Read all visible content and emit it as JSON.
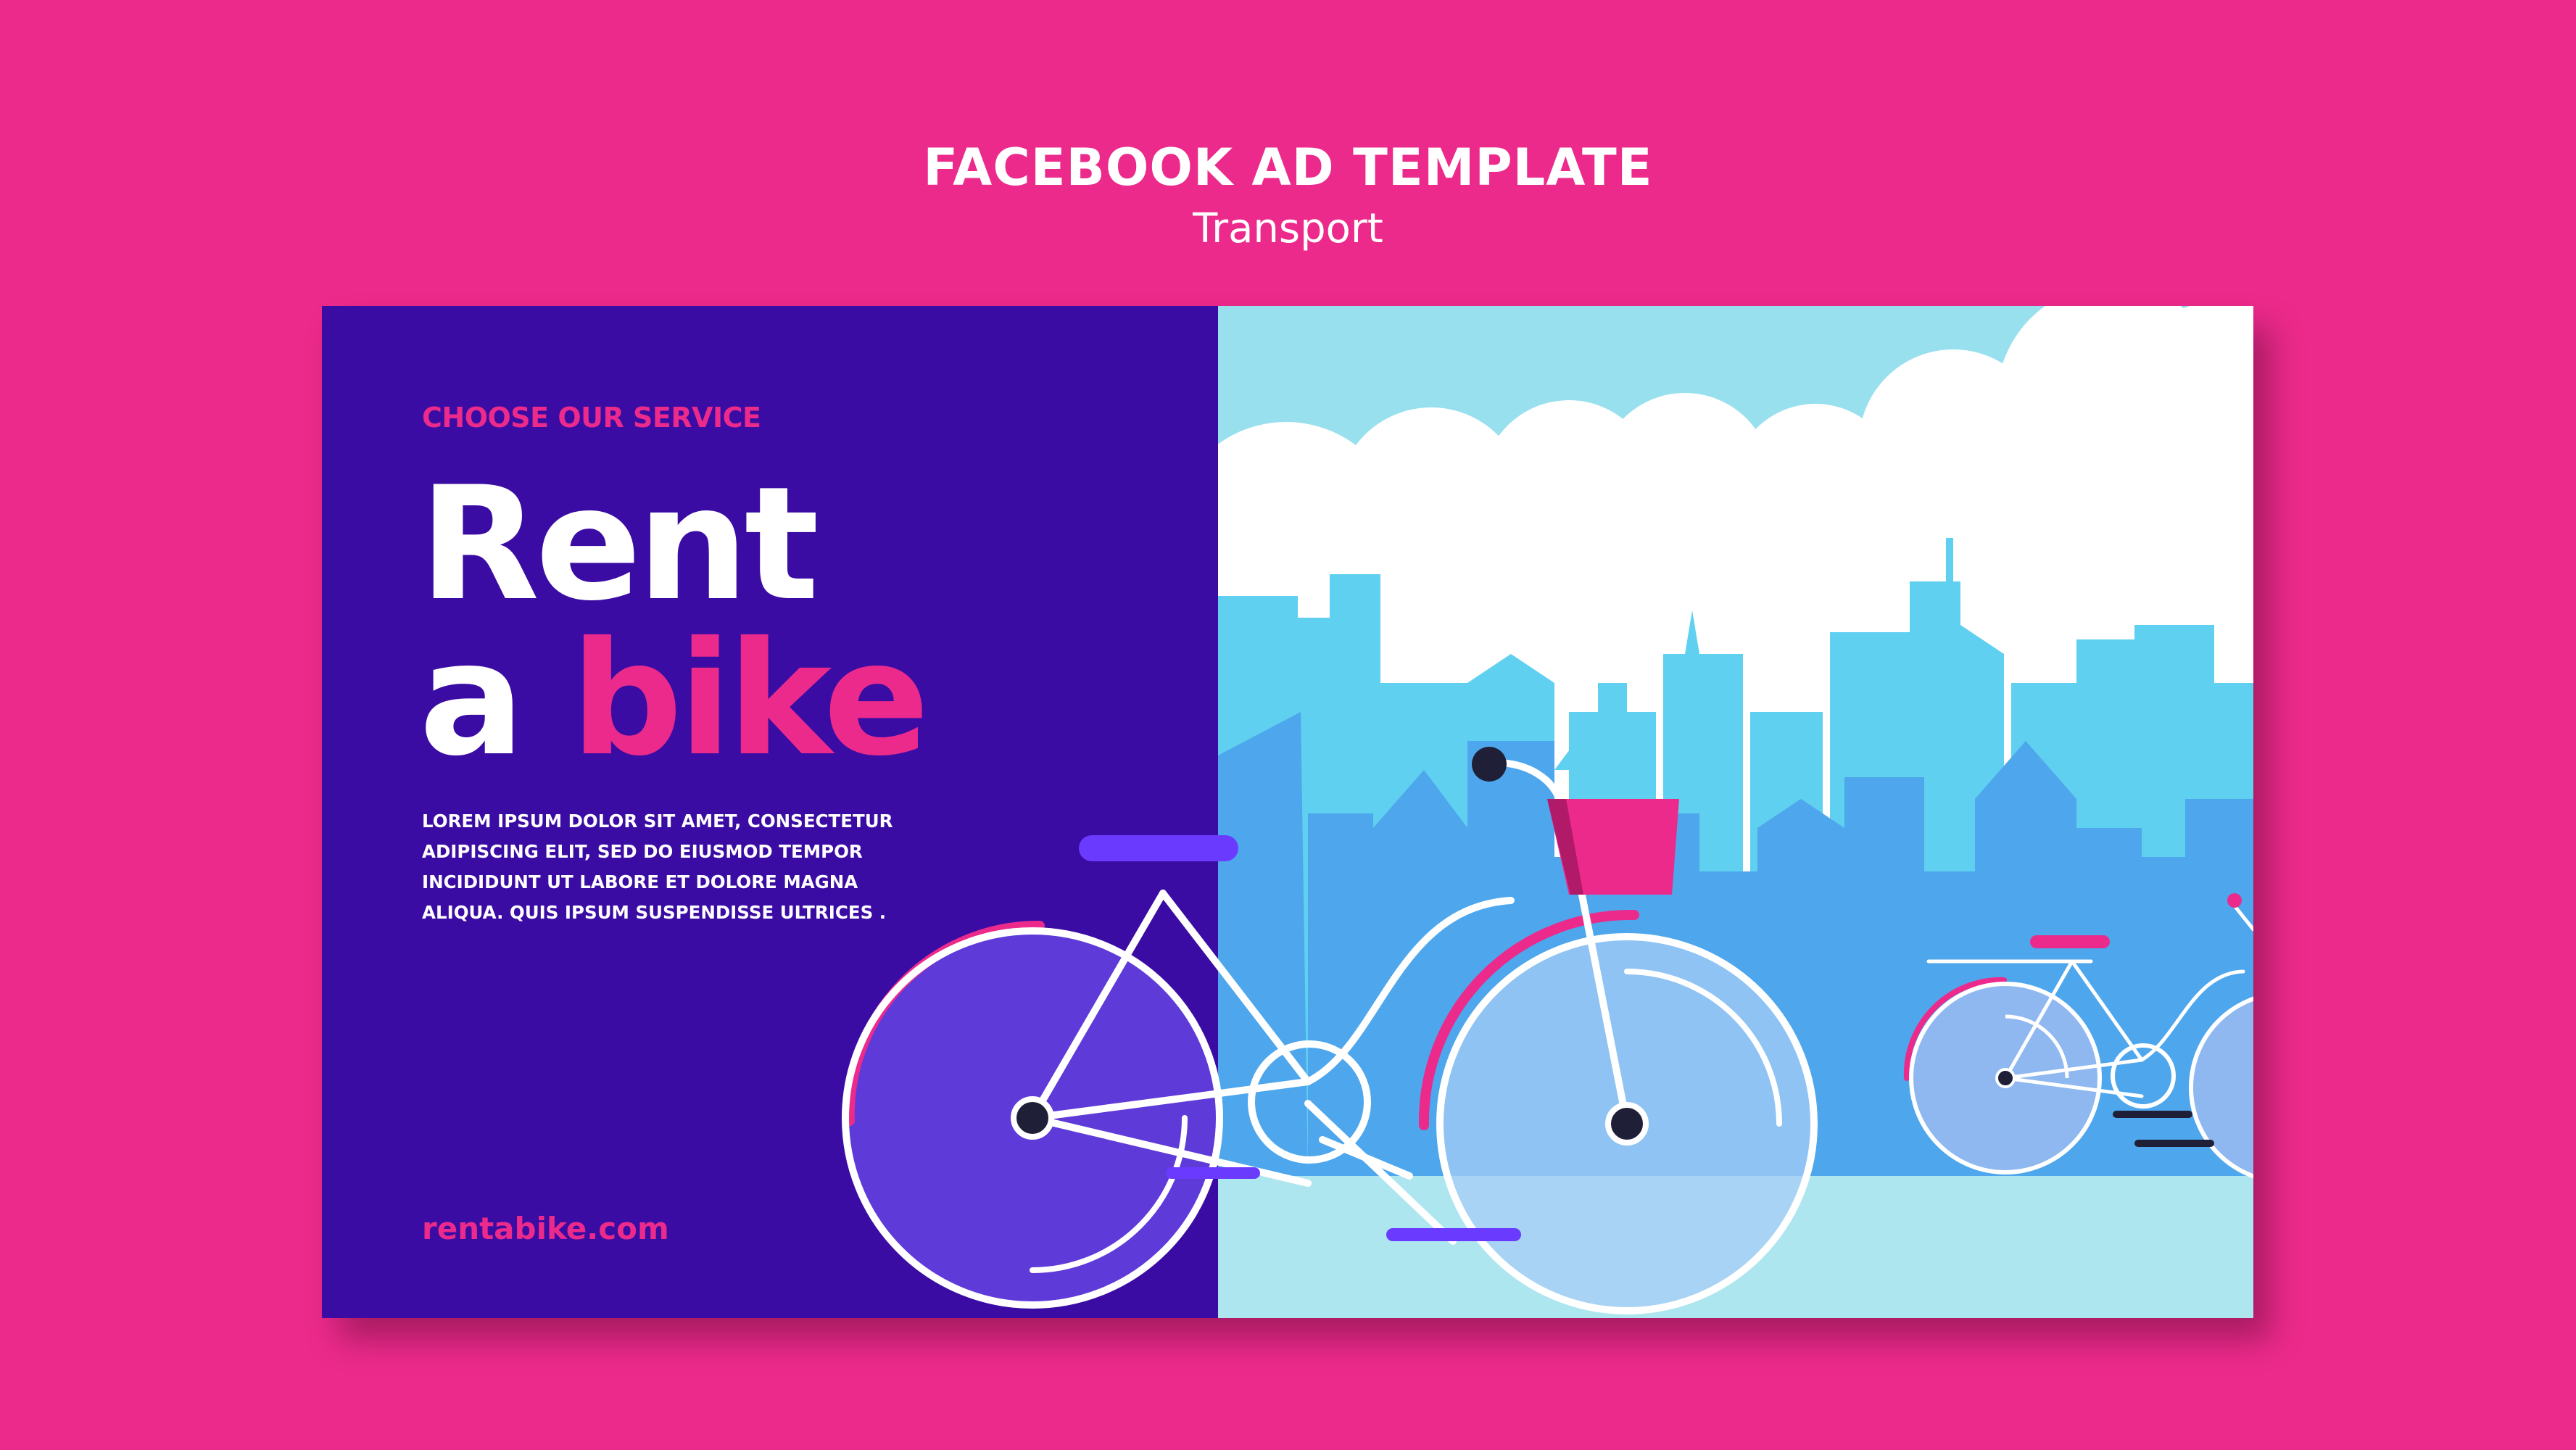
{
  "header": {
    "title": "FACEBOOK AD TEMPLATE",
    "subtitle": "Transport"
  },
  "ad": {
    "kicker": "CHOOSE OUR SERVICE",
    "headline_line1": "Rent",
    "headline_word_a": "a",
    "headline_word_bike": "bike",
    "body": "LOREM IPSUM DOLOR SIT AMET, CONSECTETUR ADIPISCING ELIT, SED DO EIUSMOD TEMPOR INCIDIDUNT UT LABORE ET DOLORE MAGNA ALIQUA. QUIS IPSUM SUSPENDISSE ULTRICES .",
    "website": "rentabike.com"
  },
  "colors": {
    "page_background": "#ec2a8b",
    "left_panel": "#3b0ca3",
    "sky": "#98e0ee",
    "accent_pink": "#ec2a8b",
    "accent_purple": "#6a3bff",
    "building_back": "#5fd0f0",
    "building_front": "#4ea6ec"
  },
  "illustration": {
    "icons": [
      "cloud-icon",
      "city-skyline-icon",
      "bicycle-icon",
      "basket-icon"
    ]
  }
}
